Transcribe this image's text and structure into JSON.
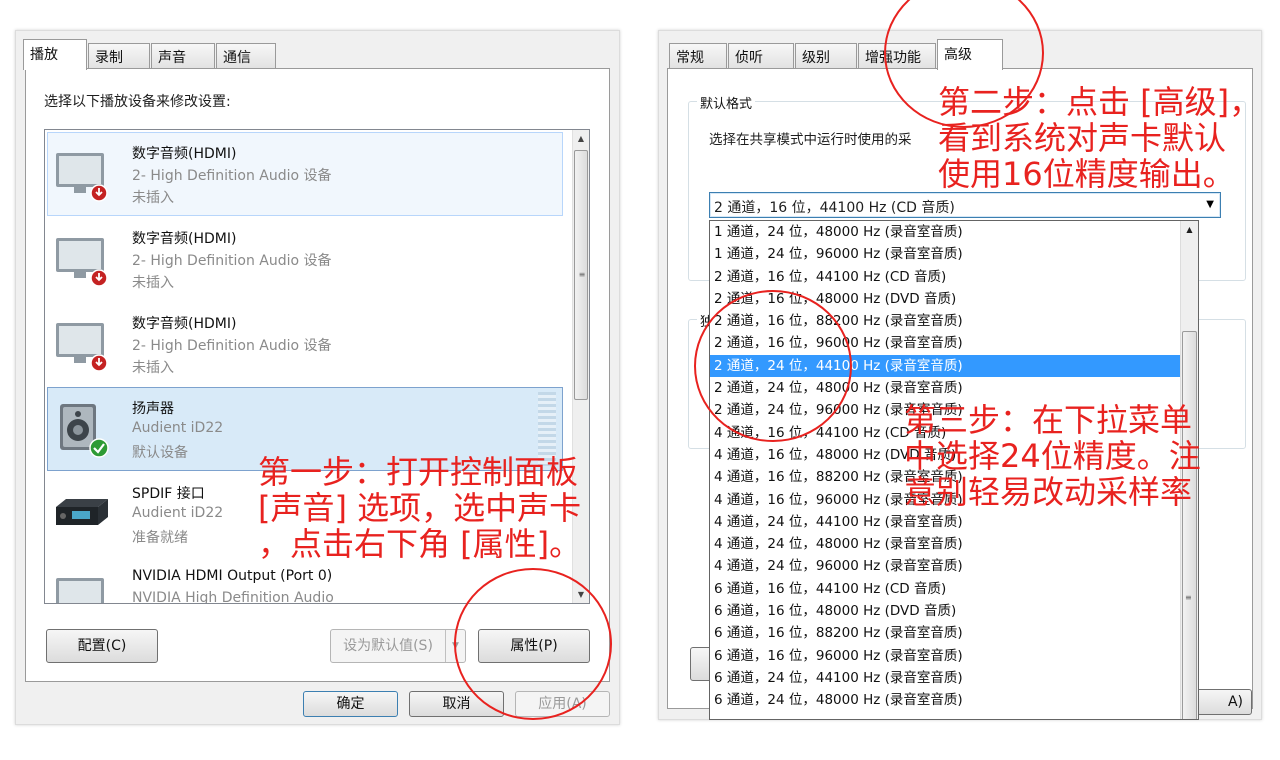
{
  "left_panel": {
    "tabs": [
      "播放",
      "录制",
      "声音",
      "通信"
    ],
    "instruction": "选择以下播放设备来修改设置:",
    "devices": [
      {
        "name": "数字音频(HDMI)",
        "sub": "2- High Definition Audio 设备",
        "status": "未插入",
        "icon": "monitor-icon"
      },
      {
        "name": "数字音频(HDMI)",
        "sub": "2- High Definition Audio 设备",
        "status": "未插入",
        "icon": "monitor-icon"
      },
      {
        "name": "数字音频(HDMI)",
        "sub": "2- High Definition Audio 设备",
        "status": "未插入",
        "icon": "monitor-icon"
      },
      {
        "name": "扬声器",
        "sub": "Audient iD22",
        "status": "默认设备",
        "icon": "speaker-icon"
      },
      {
        "name": "SPDIF 接口",
        "sub": "Audient iD22",
        "status": "准备就绪",
        "icon": "receiver-icon"
      },
      {
        "name": "NVIDIA HDMI Output (Port 0)",
        "sub": "NVIDIA High Definition Audio",
        "status": "",
        "icon": "monitor-icon"
      }
    ],
    "configure_button": "配置(C)",
    "set_default_button": "设为默认值(S)",
    "properties_button": "属性(P)",
    "ok_button": "确定",
    "cancel_button": "取消",
    "apply_button": "应用(A)"
  },
  "right_panel": {
    "tabs": [
      "常规",
      "侦听",
      "级别",
      "增强功能",
      "高级"
    ],
    "groupbox_title": "默认格式",
    "groupbox_desc": "选择在共享模式中运行时使用的采",
    "second_group_label": "独",
    "combo_value": "2 通道，16 位，44100 Hz (CD 音质)",
    "options": [
      "1 通道，24 位，48000 Hz (录音室音质)",
      "1 通道，24 位，96000 Hz (录音室音质)",
      "2 通道，16 位，44100 Hz (CD 音质)",
      "2 通道，16 位，48000 Hz (DVD 音质)",
      "2 通道，16 位，88200 Hz (录音室音质)",
      "2 通道，16 位，96000 Hz (录音室音质)",
      "2 通道，24 位，44100 Hz (录音室音质)",
      "2 通道，24 位，48000 Hz (录音室音质)",
      "2 通道，24 位，96000 Hz (录音室音质)",
      "4 通道，16 位，44100 Hz (CD 音质)",
      "4 通道，16 位，48000 Hz (DVD 音质)",
      "4 通道，16 位，88200 Hz (录音室音质)",
      "4 通道，16 位，96000 Hz (录音室音质)",
      "4 通道，24 位，44100 Hz (录音室音质)",
      "4 通道，24 位，48000 Hz (录音室音质)",
      "4 通道，24 位，96000 Hz (录音室音质)",
      "6 通道，16 位，44100 Hz (CD 音质)",
      "6 通道，16 位，48000 Hz (DVD 音质)",
      "6 通道，16 位，88200 Hz (录音室音质)",
      "6 通道，16 位，96000 Hz (录音室音质)",
      "6 通道，24 位，44100 Hz (录音室音质)",
      "6 通道，24 位，48000 Hz (录音室音质)"
    ],
    "highlighted_option": "2 通道，24 位，44100 Hz (录音室音质)",
    "apply_partial": "A)"
  },
  "annotations": {
    "step1": [
      "第一步：打开控制面板",
      "[声音] 选项，选中声卡",
      "，点击右下角 [属性]。"
    ],
    "step2": [
      "第二步：点击 [高级]，",
      "看到系统对声卡默认",
      "使用16位精度输出。"
    ],
    "step3": [
      "第三步：在下拉菜单",
      "中选择24位精度。注",
      "意别轻易改动采样率"
    ]
  },
  "colors": {
    "annotation_red": "#e8221f",
    "selection_blue": "#3399ff",
    "selected_item_bg": "#d8eaf8"
  }
}
